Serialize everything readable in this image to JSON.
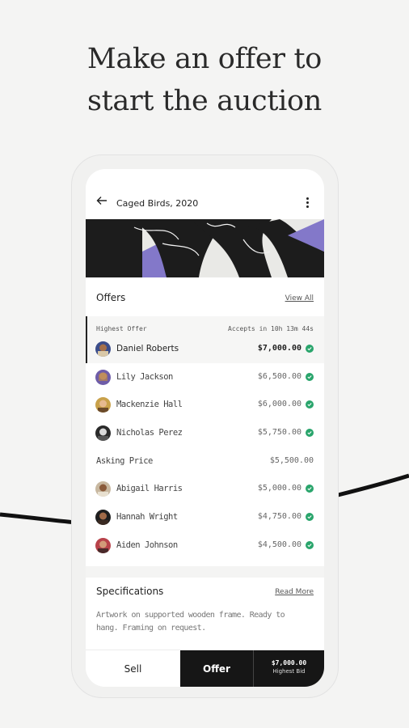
{
  "headline": {
    "line1": "Make an offer to",
    "line2": "start the auction"
  },
  "appbar": {
    "title": "Caged Birds, 2020",
    "back_icon": "arrow-left-icon",
    "menu_icon": "more-vertical-icon"
  },
  "offers": {
    "heading": "Offers",
    "view_all": "View All",
    "highest_label": "Highest Offer",
    "timer": "Accepts in 10h 13m 44s",
    "top": [
      {
        "name": "Daniel Roberts",
        "amount": "$7,000.00"
      },
      {
        "name": "Lily Jackson",
        "amount": "$6,500.00"
      },
      {
        "name": "Mackenzie Hall",
        "amount": "$6,000.00"
      },
      {
        "name": "Nicholas Perez",
        "amount": "$5,750.00"
      }
    ],
    "asking_label": "Asking Price",
    "asking_amount": "$5,500.00",
    "below": [
      {
        "name": "Abigail Harris",
        "amount": "$5,000.00"
      },
      {
        "name": "Hannah Wright",
        "amount": "$4,750.00"
      },
      {
        "name": "Aiden Johnson",
        "amount": "$4,500.00"
      }
    ]
  },
  "specifications": {
    "heading": "Specifications",
    "read_more": "Read More",
    "text": "Artwork on supported wooden frame. Ready to hang. Framing on request."
  },
  "bottom_bar": {
    "sell_label": "Sell",
    "offer_label": "Offer",
    "highest_bid_amount": "$7,000.00",
    "highest_bid_label": "Highest Bid"
  },
  "colors": {
    "accent_check": "#2aa56c",
    "dark": "#161616",
    "artwork_purple": "#8378c9"
  }
}
